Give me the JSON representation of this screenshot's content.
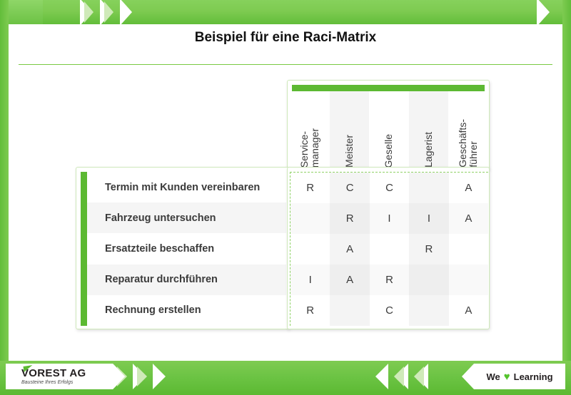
{
  "slide": {
    "title": "Beispiel für eine Raci-Matrix"
  },
  "footer": {
    "logo_name": "VOREST AG",
    "logo_tagline": "Bausteine Ihres Erfolgs",
    "learning_prefix": "We",
    "learning_heart": "♥",
    "learning_suffix": "Learning"
  },
  "matrix": {
    "columns": [
      {
        "label": "Service-\nmanager",
        "shaded": false
      },
      {
        "label": "Meister",
        "shaded": true
      },
      {
        "label": "Geselle",
        "shaded": false
      },
      {
        "label": "Lagerist",
        "shaded": true
      },
      {
        "label": "Geschäfts-\nführer",
        "shaded": false
      }
    ],
    "rows": [
      {
        "label": "Termin mit Kunden vereinbaren",
        "shaded": false
      },
      {
        "label": "Fahrzeug untersuchen",
        "shaded": true
      },
      {
        "label": "Ersatzteile beschaffen",
        "shaded": false
      },
      {
        "label": "Reparatur durchführen",
        "shaded": true
      },
      {
        "label": "Rechnung erstellen",
        "shaded": false
      }
    ],
    "cells": [
      [
        "R",
        "C",
        "C",
        "",
        "A"
      ],
      [
        "",
        "R",
        "I",
        "I",
        "A"
      ],
      [
        "",
        "A",
        "",
        "R",
        ""
      ],
      [
        "I",
        "A",
        "R",
        "",
        ""
      ],
      [
        "R",
        "",
        "C",
        "",
        "A"
      ]
    ]
  },
  "colors": {
    "brand_green": "#5cb932",
    "band_green": "#7ecb51",
    "rule_green": "#7ac943",
    "dash_green": "#8fd266",
    "card_border": "#cfe9bb",
    "shade_gray": "#f4f4f4",
    "text_dark": "#3b3b3b"
  }
}
